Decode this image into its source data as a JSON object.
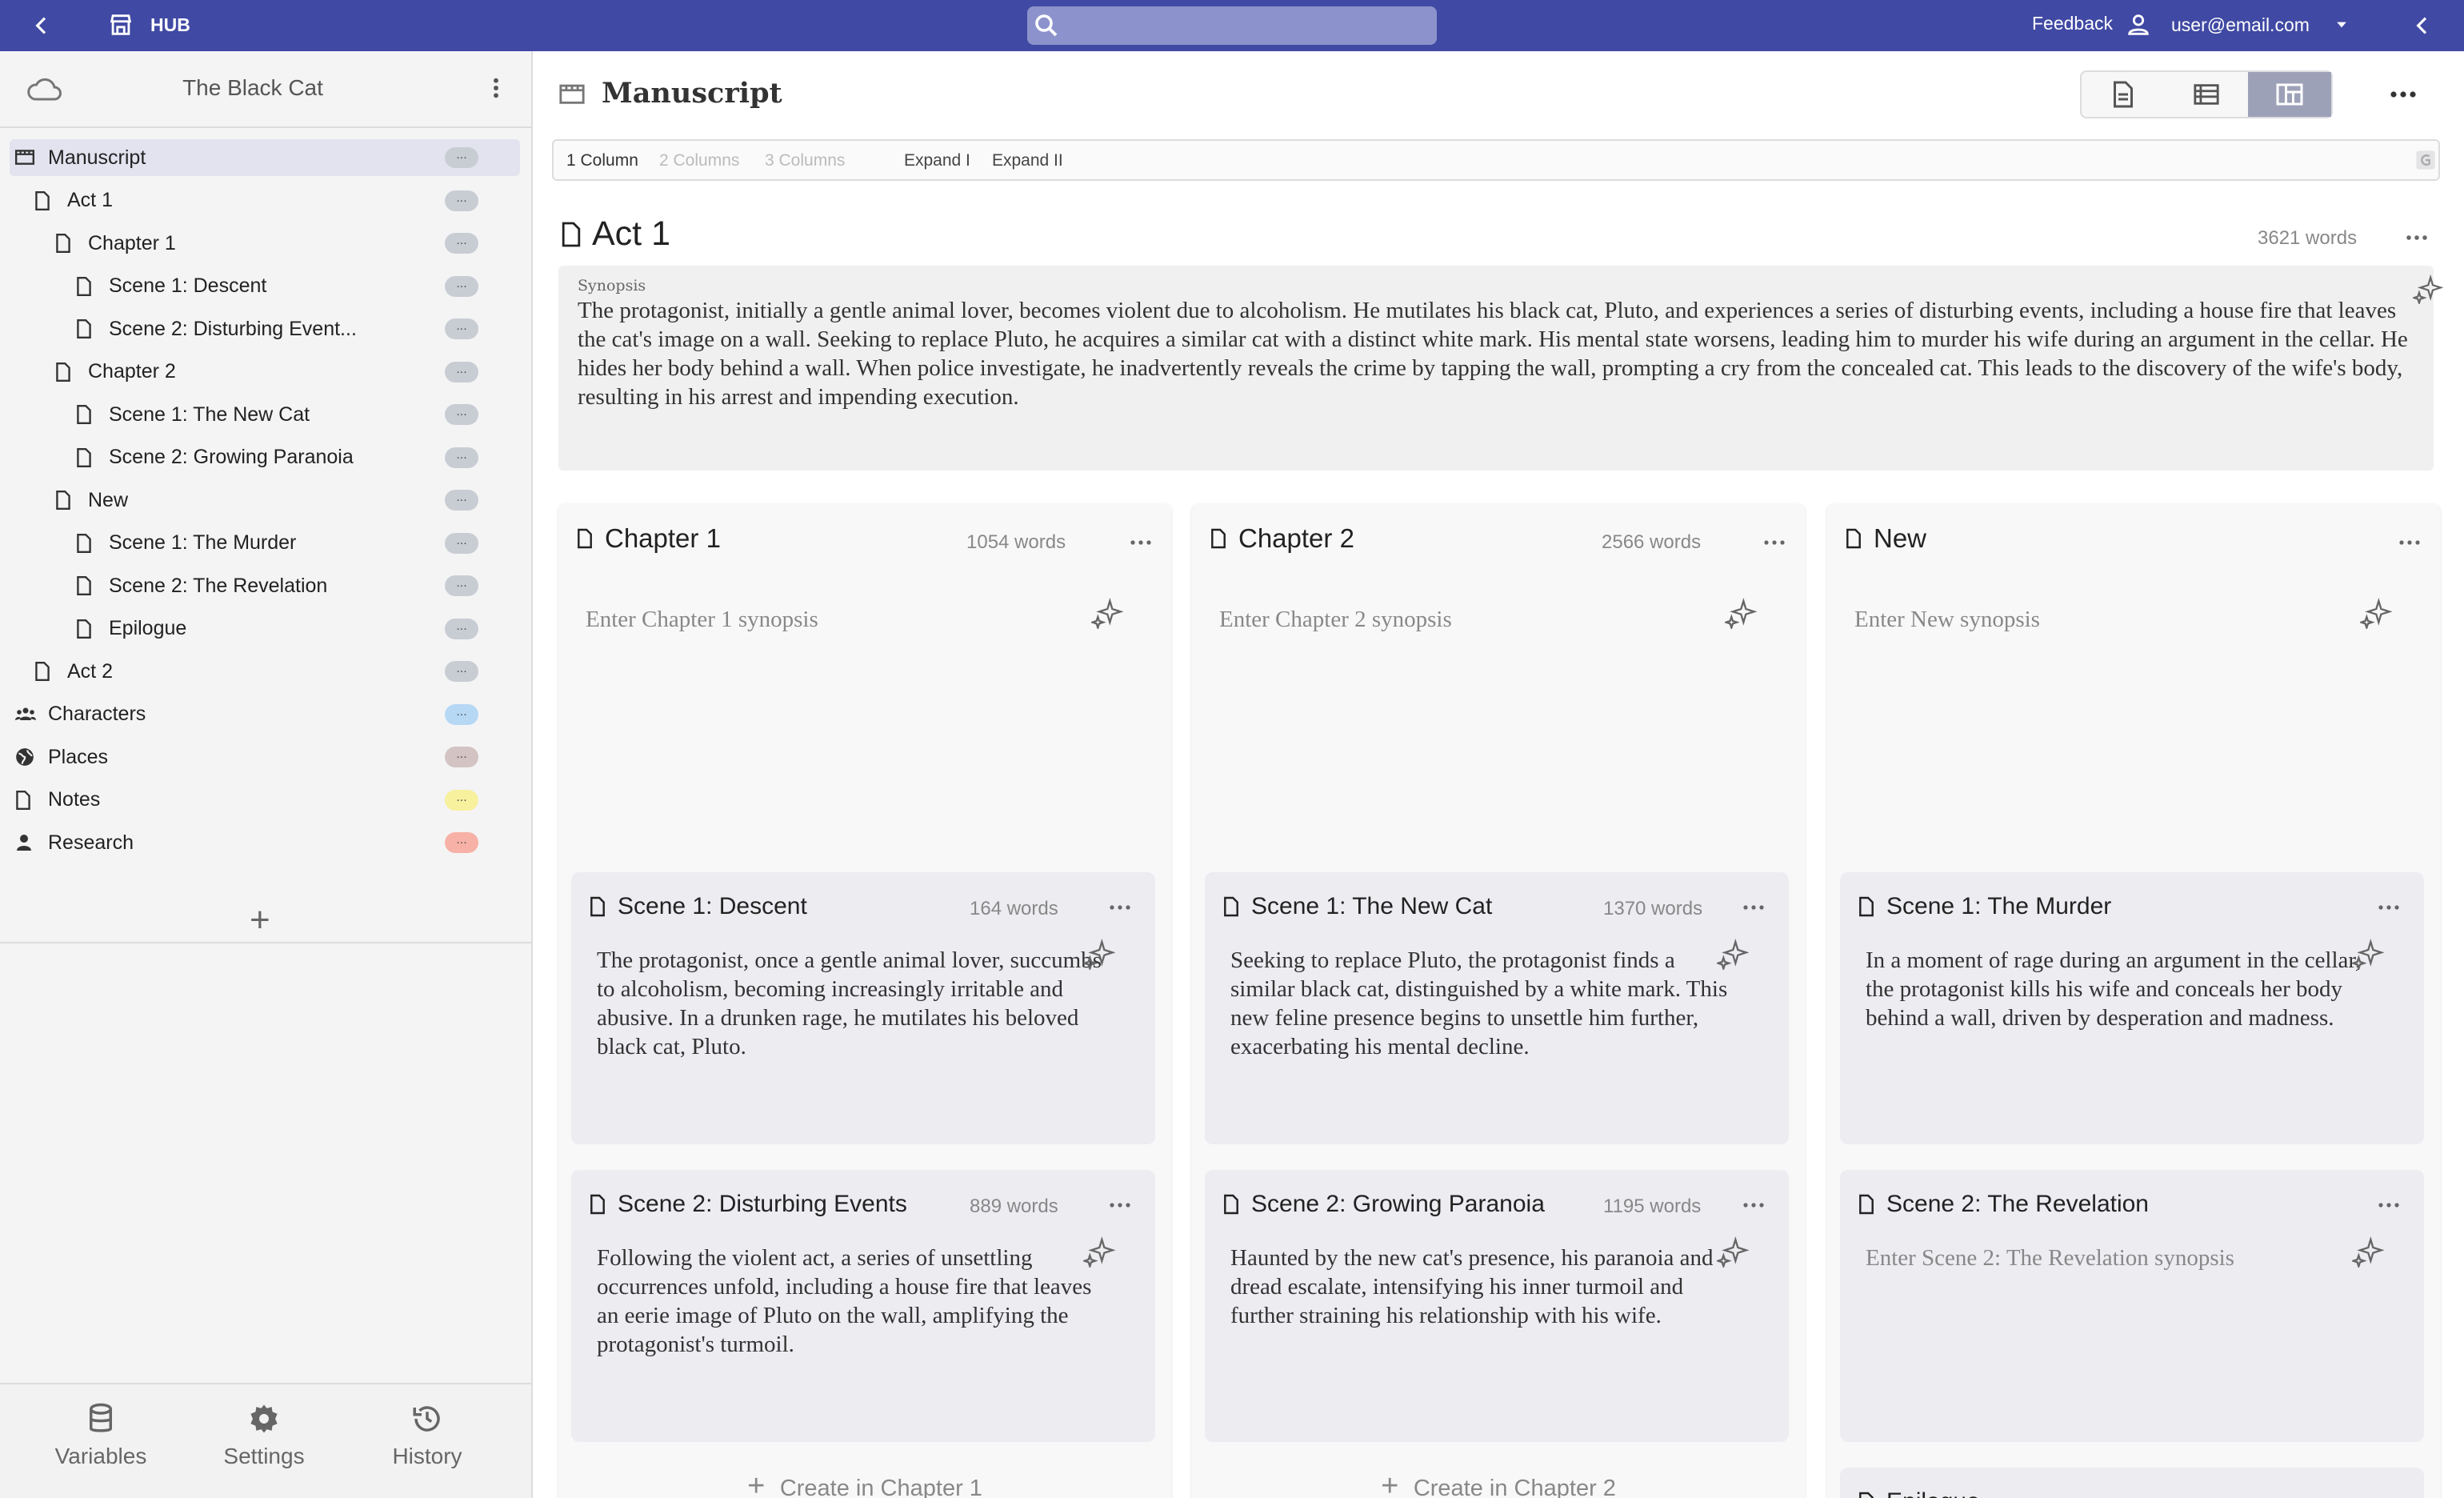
{
  "topbar": {
    "hub_label": "HUB",
    "search_placeholder": "",
    "feedback_label": "Feedback",
    "user_email": "user@email.com"
  },
  "sidebar": {
    "project_title": "The Black Cat",
    "tree": [
      {
        "label": "Manuscript",
        "icon": "manuscript-icon",
        "pill": "...",
        "pill_color": "#c8cdd3"
      },
      {
        "label": "Act 1",
        "icon": "document-icon",
        "pill": "...",
        "pill_color": "#c8cdd3"
      },
      {
        "label": "Chapter 1",
        "icon": "document-icon",
        "pill": "...",
        "pill_color": "#c8cdd3"
      },
      {
        "label": "Scene 1: Descent",
        "icon": "document-icon",
        "pill": "...",
        "pill_color": "#c8cdd3"
      },
      {
        "label": "Scene 2: Disturbing Event...",
        "icon": "document-icon",
        "pill": "...",
        "pill_color": "#c8cdd3"
      },
      {
        "label": "Chapter 2",
        "icon": "document-icon",
        "pill": "...",
        "pill_color": "#c8cdd3"
      },
      {
        "label": "Scene 1: The New Cat",
        "icon": "document-icon",
        "pill": "...",
        "pill_color": "#c8cdd3"
      },
      {
        "label": "Scene 2: Growing Paranoia",
        "icon": "document-icon",
        "pill": "...",
        "pill_color": "#c8cdd3"
      },
      {
        "label": "New",
        "icon": "document-icon",
        "pill": "...",
        "pill_color": "#c8cdd3"
      },
      {
        "label": "Scene 1: The Murder",
        "icon": "document-icon",
        "pill": "...",
        "pill_color": "#c8cdd3"
      },
      {
        "label": "Scene 2: The Revelation",
        "icon": "document-icon",
        "pill": "...",
        "pill_color": "#c8cdd3"
      },
      {
        "label": "Epilogue",
        "icon": "document-icon",
        "pill": "...",
        "pill_color": "#c8cdd3"
      },
      {
        "label": "Act 2",
        "icon": "document-icon",
        "pill": "...",
        "pill_color": "#c8cdd3"
      },
      {
        "label": "Characters",
        "icon": "people-icon",
        "pill": "...",
        "pill_color": "#b6d8f5"
      },
      {
        "label": "Places",
        "icon": "globe-icon",
        "pill": "...",
        "pill_color": "#d3c3c3"
      },
      {
        "label": "Notes",
        "icon": "document-icon",
        "pill": "...",
        "pill_color": "#f7f19e"
      },
      {
        "label": "Research",
        "icon": "person-icon",
        "pill": "...",
        "pill_color": "#f7b1a6"
      }
    ],
    "bottom": {
      "variables": "Variables",
      "settings": "Settings",
      "history": "History"
    }
  },
  "main": {
    "title": "Manuscript",
    "column_options": {
      "one": "1 Column",
      "two": "2 Columns",
      "three": "3 Columns",
      "expand1": "Expand I",
      "expand2": "Expand II"
    },
    "act": {
      "title": "Act 1",
      "words": "3621 words",
      "synopsis_label": "Synopsis",
      "synopsis": "The protagonist, initially a gentle animal lover, becomes violent due to alcoholism. He mutilates his black cat, Pluto, and experiences a series of disturbing events, including a house fire that leaves the cat's image on a wall. Seeking to replace Pluto, he acquires a similar cat with a distinct white mark. His mental state worsens, leading him to murder his wife during an argument in the cellar. He hides her body behind a wall. When police investigate, he inadvertently reveals the crime by tapping the wall, prompting a cry from the concealed cat. This leads to the discovery of the wife's body, resulting in his arrest and impending execution."
    },
    "columns": [
      {
        "title": "Chapter 1",
        "words": "1054 words",
        "synopsis_placeholder": "Enter Chapter 1 synopsis",
        "create_label": "Create in Chapter 1",
        "cards": [
          {
            "title": "Scene 1: Descent",
            "words": "164 words",
            "text": "The protagonist, once a gentle animal lover, succumbs to alcoholism, becoming increasingly irritable and abusive. In a drunken rage, he mutilates his beloved black cat, Pluto."
          },
          {
            "title": "Scene 2: Disturbing Events",
            "words": "889 words",
            "text": "Following the violent act, a series of unsettling occurrences unfold, including a house fire that leaves an eerie image of Pluto on the wall, amplifying the protagonist's turmoil."
          }
        ]
      },
      {
        "title": "Chapter 2",
        "words": "2566 words",
        "synopsis_placeholder": "Enter Chapter 2 synopsis",
        "create_label": "Create in Chapter 2",
        "cards": [
          {
            "title": "Scene 1: The New Cat",
            "words": "1370 words",
            "text": "Seeking to replace Pluto, the protagonist finds a similar black cat, distinguished by a white mark. This new feline presence begins to unsettle him further, exacerbating his mental decline."
          },
          {
            "title": "Scene 2: Growing Paranoia",
            "words": "1195 words",
            "text": "Haunted by the new cat's presence, his paranoia and dread escalate, intensifying his inner turmoil and further straining his relationship with his wife."
          }
        ]
      },
      {
        "title": "New",
        "words": "",
        "synopsis_placeholder": "Enter New synopsis",
        "create_label": "",
        "cards": [
          {
            "title": "Scene 1: The Murder",
            "words": "",
            "text": "In a moment of rage during an argument in the cellar, the protagonist kills his wife and conceals her body behind a wall, driven by desperation and madness."
          },
          {
            "title": "Scene 2: The Revelation",
            "words": "",
            "text": "Enter Scene 2: The Revelation synopsis"
          },
          {
            "title": "Epilogue",
            "words": "",
            "text": ""
          }
        ]
      }
    ]
  }
}
